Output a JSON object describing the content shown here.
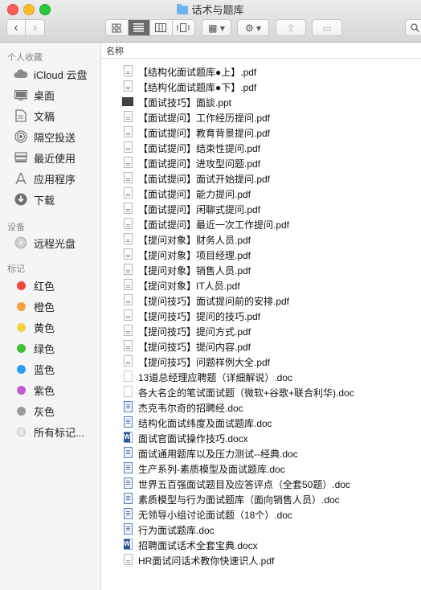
{
  "window": {
    "title": "话术与题库"
  },
  "toolbar": {
    "back": "‹",
    "forward": "›",
    "arrange": "▦ ▾",
    "action": "⚙ ▾",
    "share": "⇪",
    "tag": "▭"
  },
  "sidebar": {
    "favorites_header": "个人收藏",
    "favorites": [
      {
        "label": "iCloud 云盘",
        "icon": "cloud-icon"
      },
      {
        "label": "桌面",
        "icon": "desktop-icon"
      },
      {
        "label": "文稿",
        "icon": "documents-icon"
      },
      {
        "label": "隔空投送",
        "icon": "airdrop-icon"
      },
      {
        "label": "最近使用",
        "icon": "recents-icon"
      },
      {
        "label": "应用程序",
        "icon": "applications-icon"
      },
      {
        "label": "下载",
        "icon": "downloads-icon"
      }
    ],
    "devices_header": "设备",
    "devices": [
      {
        "label": "远程光盘",
        "icon": "disc-icon"
      }
    ],
    "tags_header": "标记",
    "tags": [
      {
        "label": "红色",
        "color": "#f0463c"
      },
      {
        "label": "橙色",
        "color": "#f5a23a"
      },
      {
        "label": "黄色",
        "color": "#f7d23c"
      },
      {
        "label": "绿色",
        "color": "#3ec13a"
      },
      {
        "label": "蓝色",
        "color": "#2f9cf0"
      },
      {
        "label": "紫色",
        "color": "#c05ad2"
      },
      {
        "label": "灰色",
        "color": "#9a9a9a"
      },
      {
        "label": "所有标记...",
        "color": "#e6e6e6"
      }
    ]
  },
  "list": {
    "column_name": "名称",
    "files": [
      {
        "name": "【结构化面试题库●上】.pdf",
        "type": "pdf"
      },
      {
        "name": "【结构化面试题库●下】.pdf",
        "type": "pdf"
      },
      {
        "name": "【面试技巧】面談.ppt",
        "type": "ppt"
      },
      {
        "name": "【面试提问】工作经历提问.pdf",
        "type": "pdf"
      },
      {
        "name": "【面试提问】教育背景提问.pdf",
        "type": "pdf"
      },
      {
        "name": "【面试提问】结束性提问.pdf",
        "type": "pdf"
      },
      {
        "name": "【面试提问】进攻型问题.pdf",
        "type": "pdf"
      },
      {
        "name": "【面试提问】面试开始提问.pdf",
        "type": "pdf"
      },
      {
        "name": "【面试提问】能力提问.pdf",
        "type": "pdf"
      },
      {
        "name": "【面试提问】闲聊式提问.pdf",
        "type": "pdf"
      },
      {
        "name": "【面试提问】最近一次工作提问.pdf",
        "type": "pdf"
      },
      {
        "name": "【提问对象】财务人员.pdf",
        "type": "pdf"
      },
      {
        "name": "【提问对象】项目经理.pdf",
        "type": "pdf"
      },
      {
        "name": "【提问对象】销售人员.pdf",
        "type": "pdf"
      },
      {
        "name": "【提问对象】IT人员.pdf",
        "type": "pdf"
      },
      {
        "name": "【提问技巧】面试提问前的安排.pdf",
        "type": "pdf"
      },
      {
        "name": "【提问技巧】提问的技巧.pdf",
        "type": "pdf"
      },
      {
        "name": "【提问技巧】提问方式.pdf",
        "type": "pdf"
      },
      {
        "name": "【提问技巧】提问内容.pdf",
        "type": "pdf"
      },
      {
        "name": "【提问技巧】问题样例大全.pdf",
        "type": "pdf"
      },
      {
        "name": "13道总经理应聘题（详细解说）.doc",
        "type": "blank"
      },
      {
        "name": "各大名企的笔试面试题（微软+谷歌+联合利华).doc",
        "type": "blank"
      },
      {
        "name": "杰克韦尔奇的招聘经.doc",
        "type": "doc"
      },
      {
        "name": "结构化面试纬度及面试题库.doc",
        "type": "doc"
      },
      {
        "name": "面试官面试操作技巧.docx",
        "type": "docx"
      },
      {
        "name": "面试通用题库以及压力测试--经典.doc",
        "type": "doc"
      },
      {
        "name": "生产系列-素质模型及面试题库.doc",
        "type": "doc"
      },
      {
        "name": "世界五百强面试题目及应答评点（全套50题）.doc",
        "type": "doc"
      },
      {
        "name": "素质模型与行为面试题库（面向销售人员）.doc",
        "type": "doc"
      },
      {
        "name": "无领导小组讨论面试题（18个）.doc",
        "type": "doc"
      },
      {
        "name": "行为面试题库.doc",
        "type": "doc"
      },
      {
        "name": "招聘面试话术全套宝典.docx",
        "type": "docx"
      },
      {
        "name": "HR面试问话术教你快速识人.pdf",
        "type": "pdf"
      }
    ]
  }
}
